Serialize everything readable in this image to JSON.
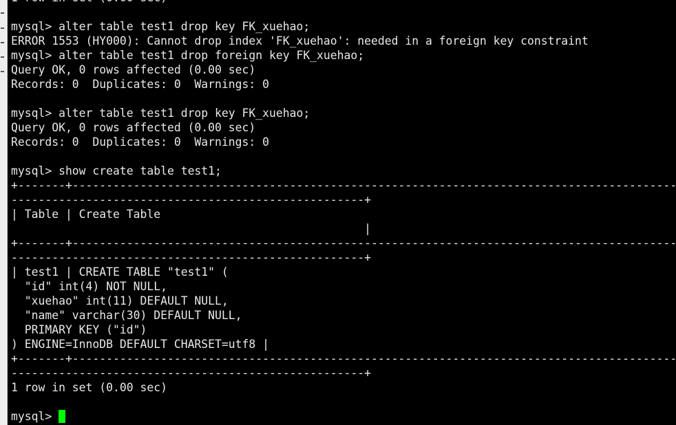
{
  "terminal": {
    "lines": [
      "1 row in set (0.00 sec)",
      "",
      "mysql> alter table test1 drop key FK_xuehao;",
      "ERROR 1553 (HY000): Cannot drop index 'FK_xuehao': needed in a foreign key constraint",
      "mysql> alter table test1 drop foreign key FK_xuehao;",
      "Query OK, 0 rows affected (0.00 sec)",
      "Records: 0  Duplicates: 0  Warnings: 0",
      "",
      "mysql> alter table test1 drop key FK_xuehao;",
      "Query OK, 0 rows affected (0.00 sec)",
      "Records: 0  Duplicates: 0  Warnings: 0",
      "",
      "mysql> show create table test1;",
      "+-------+------------------------------------------------------------------------------------------",
      "----------------------------------------------------+",
      "| Table | Create Table",
      "                                                    |",
      "+-------+------------------------------------------------------------------------------------------",
      "----------------------------------------------------+",
      "| test1 | CREATE TABLE \"test1\" (",
      "  \"id\" int(4) NOT NULL,",
      "  \"xuehao\" int(11) DEFAULT NULL,",
      "  \"name\" varchar(30) DEFAULT NULL,",
      "  PRIMARY KEY (\"id\")",
      ") ENGINE=InnoDB DEFAULT CHARSET=utf8 |",
      "+-------+------------------------------------------------------------------------------------------",
      "----------------------------------------------------+",
      "1 row in set (0.00 sec)",
      ""
    ],
    "prompt": "mysql> ",
    "cursor_color": "#00ff00",
    "text_color": "#e8e8e8",
    "background_color": "#000000"
  }
}
